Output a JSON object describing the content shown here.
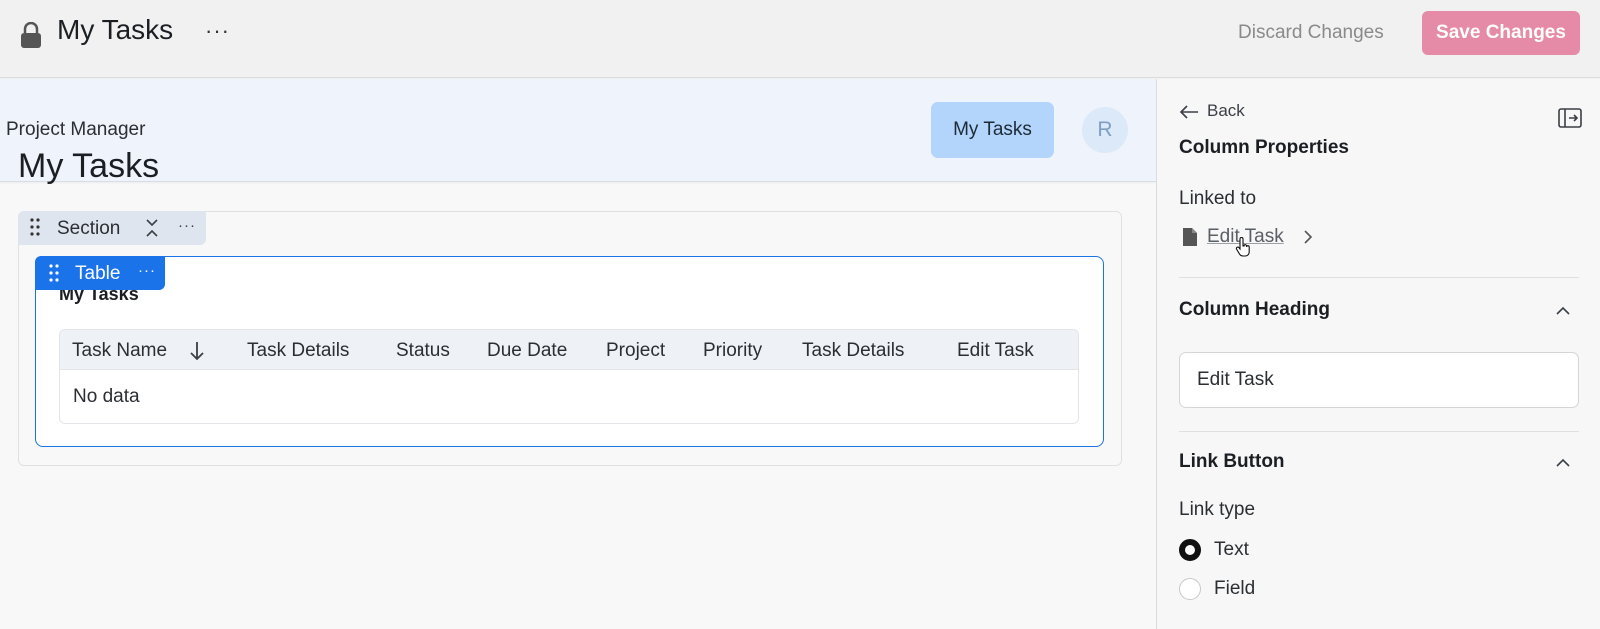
{
  "topbar": {
    "title": "My Tasks",
    "more": "···",
    "discard_label": "Discard Changes",
    "save_label": "Save Changes"
  },
  "app_header": {
    "app_name": "Project Manager",
    "nav_item": "My Tasks",
    "avatar_initial": "R"
  },
  "page": {
    "heading": "My Tasks"
  },
  "section_tag": {
    "label": "Section",
    "collapse": "⌄",
    "more": "···"
  },
  "table_tag": {
    "label": "Table",
    "more": "···"
  },
  "table": {
    "title": "My Tasks",
    "columns": [
      "Task Name",
      "Task Details",
      "Status",
      "Due Date",
      "Project",
      "Priority",
      "Task Details",
      "Edit Task"
    ],
    "empty_text": "No data"
  },
  "panel": {
    "back_label": "Back",
    "title": "Column Properties",
    "linked_label": "Linked to",
    "linked_value": "Edit Task",
    "column_heading": {
      "title": "Column Heading",
      "value": "Edit Task"
    },
    "link_button": {
      "title": "Link Button",
      "link_type_label": "Link type",
      "options": [
        "Text",
        "Field"
      ],
      "selected": "Text"
    }
  },
  "colors": {
    "accent": "#1a73e8",
    "save_button": "#e58ba7",
    "nav_pill": "#b3d4fb"
  }
}
